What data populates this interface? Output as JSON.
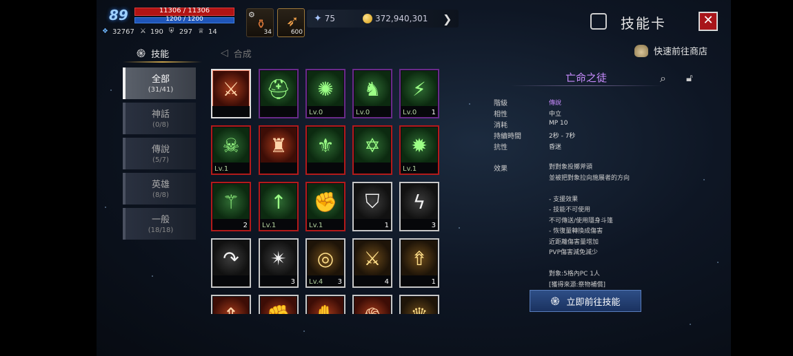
{
  "player": {
    "level": "89",
    "hp": "11306 / 11306",
    "mp": "1200 / 1200",
    "stats": [
      "32767",
      "190",
      "297",
      "14"
    ]
  },
  "items": [
    {
      "icon": "potion-icon",
      "count": "34"
    },
    {
      "icon": "feather-icon",
      "count": "600"
    }
  ],
  "currency": {
    "crystal": "75",
    "gold": "372,940,301"
  },
  "header": {
    "title": "技能卡"
  },
  "tabs": {
    "skill": "技能",
    "synthesis": "合成"
  },
  "shop_link": "快速前往商店",
  "categories": [
    {
      "name": "全部",
      "count": "(31/41)"
    },
    {
      "name": "神話",
      "count": "(0/8)"
    },
    {
      "name": "傳說",
      "count": "(5/7)"
    },
    {
      "name": "英雄",
      "count": "(8/8)"
    },
    {
      "name": "一般",
      "count": "(18/18)"
    }
  ],
  "grid": [
    {
      "icon": "blade-slash-icon",
      "glyph": "⚔",
      "theme": "g-fire",
      "frame": "sel",
      "lv": "",
      "num": ""
    },
    {
      "icon": "helm-icon",
      "glyph": "⛑",
      "theme": "g-green",
      "frame": "purple",
      "lv": "",
      "num": ""
    },
    {
      "icon": "burst-icon",
      "glyph": "✺",
      "theme": "g-green",
      "frame": "purple",
      "lv": "Lv.0",
      "num": ""
    },
    {
      "icon": "warrior-icon",
      "glyph": "♞",
      "theme": "g-green",
      "frame": "purple",
      "lv": "Lv.0",
      "num": ""
    },
    {
      "icon": "sword-strike-icon",
      "glyph": "⚡",
      "theme": "g-green",
      "frame": "purple",
      "lv": "Lv.0",
      "num": "1"
    },
    {
      "icon": "skull-shield-icon",
      "glyph": "☠",
      "theme": "g-green",
      "frame": "red",
      "lv": "Lv.1",
      "num": ""
    },
    {
      "icon": "fire-warrior-icon",
      "glyph": "♜",
      "theme": "g-fire",
      "frame": "red",
      "lv": "",
      "num": ""
    },
    {
      "icon": "sword-emblem-icon",
      "glyph": "⚜",
      "theme": "g-green",
      "frame": "red",
      "lv": "",
      "num": ""
    },
    {
      "icon": "star-emblem-icon",
      "glyph": "✡",
      "theme": "g-green",
      "frame": "red",
      "lv": "",
      "num": ""
    },
    {
      "icon": "explosion-icon",
      "glyph": "✹",
      "theme": "g-green",
      "frame": "red",
      "lv": "Lv.1",
      "num": ""
    },
    {
      "icon": "triple-sword-icon",
      "glyph": "⚚",
      "theme": "g-green",
      "frame": "red",
      "lv": "",
      "num": "2"
    },
    {
      "icon": "muscle-up-icon",
      "glyph": "↑",
      "theme": "g-green",
      "frame": "red",
      "lv": "Lv.1",
      "num": ""
    },
    {
      "icon": "fists-icon",
      "glyph": "✊",
      "theme": "g-green",
      "frame": "red",
      "lv": "Lv.1",
      "num": ""
    },
    {
      "icon": "shield-icon",
      "glyph": "⛉",
      "theme": "g-dark",
      "frame": "white",
      "lv": "",
      "num": "1"
    },
    {
      "icon": "lightning-icon",
      "glyph": "ϟ",
      "theme": "g-dark",
      "frame": "white",
      "lv": "",
      "num": "3"
    },
    {
      "icon": "hook-arrow-icon",
      "glyph": "↷",
      "theme": "g-dark",
      "frame": "white",
      "lv": "",
      "num": ""
    },
    {
      "icon": "starburst-icon",
      "glyph": "✴",
      "theme": "g-dark",
      "frame": "white",
      "lv": "",
      "num": "3"
    },
    {
      "icon": "ring-emblem-icon",
      "glyph": "◎",
      "theme": "g-gold",
      "frame": "white",
      "lv": "Lv.4",
      "num": "3"
    },
    {
      "icon": "crossed-swords-icon",
      "glyph": "⚔",
      "theme": "g-gold",
      "frame": "white",
      "lv": "",
      "num": "4"
    },
    {
      "icon": "power-up-icon",
      "glyph": "⇮",
      "theme": "g-gold",
      "frame": "white",
      "lv": "",
      "num": "1"
    },
    {
      "icon": "arrow-up-icon",
      "glyph": "⇑",
      "theme": "g-fire",
      "frame": "white",
      "lv": "",
      "num": ""
    },
    {
      "icon": "punch-icon",
      "glyph": "✊",
      "theme": "g-fire",
      "frame": "white",
      "lv": "",
      "num": ""
    },
    {
      "icon": "fist-icon",
      "glyph": "✋",
      "theme": "g-fire",
      "frame": "white",
      "lv": "",
      "num": ""
    },
    {
      "icon": "swirl-icon",
      "glyph": "֍",
      "theme": "g-fire",
      "frame": "white",
      "lv": "",
      "num": ""
    },
    {
      "icon": "crown-icon",
      "glyph": "♛",
      "theme": "g-gold",
      "frame": "white",
      "lv": "",
      "num": ""
    }
  ],
  "detail": {
    "name": "亡命之徒",
    "attrs": [
      {
        "label": "階級",
        "value": "傳說"
      },
      {
        "label": "相性",
        "value": "中立"
      },
      {
        "label": "消耗",
        "value": "MP 10"
      },
      {
        "label": "持續時間",
        "value": "2秒 - 7秒"
      },
      {
        "label": "抗性",
        "value": "昏迷"
      }
    ],
    "effect_label": "效果",
    "effects": [
      "對對象投擲斧頭",
      "並被把對象拉向施展者的方向",
      "",
      "- 支援效果",
      "- 技能不可使用",
      "不可傳送/使用隱身斗篷",
      "- 恢復量轉換成傷害",
      "近距離傷害量增加",
      "PVP傷害減免減少",
      "",
      "對象:5格內PC 1人",
      "[獲得來源:祭物補償]"
    ]
  },
  "go_button": "立即前往技能"
}
